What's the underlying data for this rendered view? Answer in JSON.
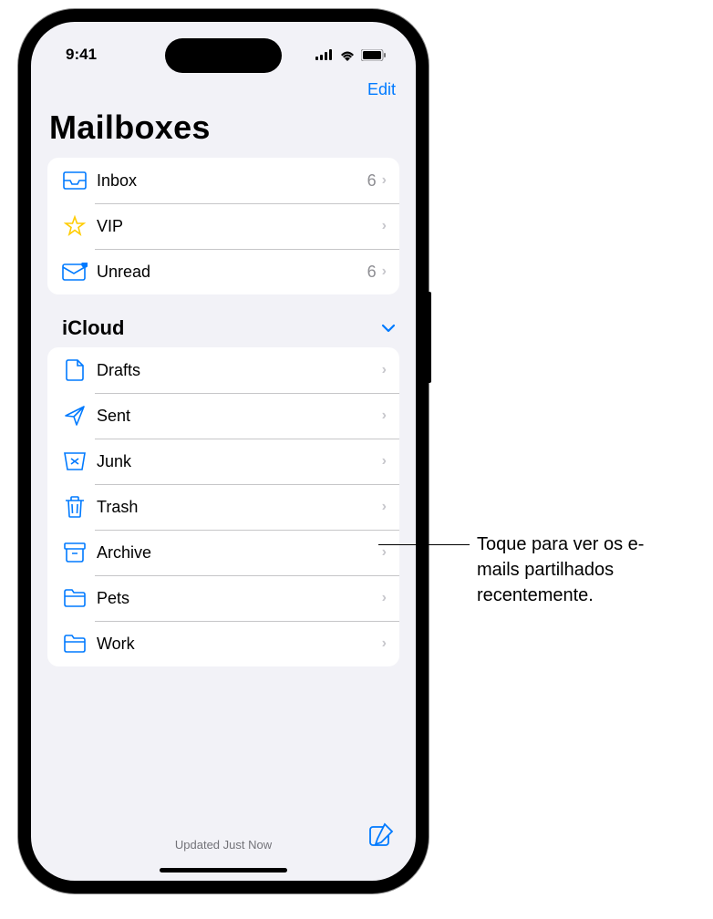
{
  "statusBar": {
    "time": "9:41"
  },
  "navBar": {
    "editLabel": "Edit"
  },
  "title": "Mailboxes",
  "topMailboxes": [
    {
      "label": "Inbox",
      "count": "6",
      "icon": "inbox"
    },
    {
      "label": "VIP",
      "count": "",
      "icon": "star"
    },
    {
      "label": "Unread",
      "count": "6",
      "icon": "unread"
    }
  ],
  "accountSection": {
    "header": "iCloud",
    "mailboxes": [
      {
        "label": "Drafts",
        "icon": "draft"
      },
      {
        "label": "Sent",
        "icon": "sent"
      },
      {
        "label": "Junk",
        "icon": "junk"
      },
      {
        "label": "Trash",
        "icon": "trash"
      },
      {
        "label": "Archive",
        "icon": "archive"
      },
      {
        "label": "Pets",
        "icon": "folder"
      },
      {
        "label": "Work",
        "icon": "folder"
      }
    ]
  },
  "bottomBar": {
    "status": "Updated Just Now"
  },
  "callout": "Toque para ver os e-mails partilhados recentemente."
}
